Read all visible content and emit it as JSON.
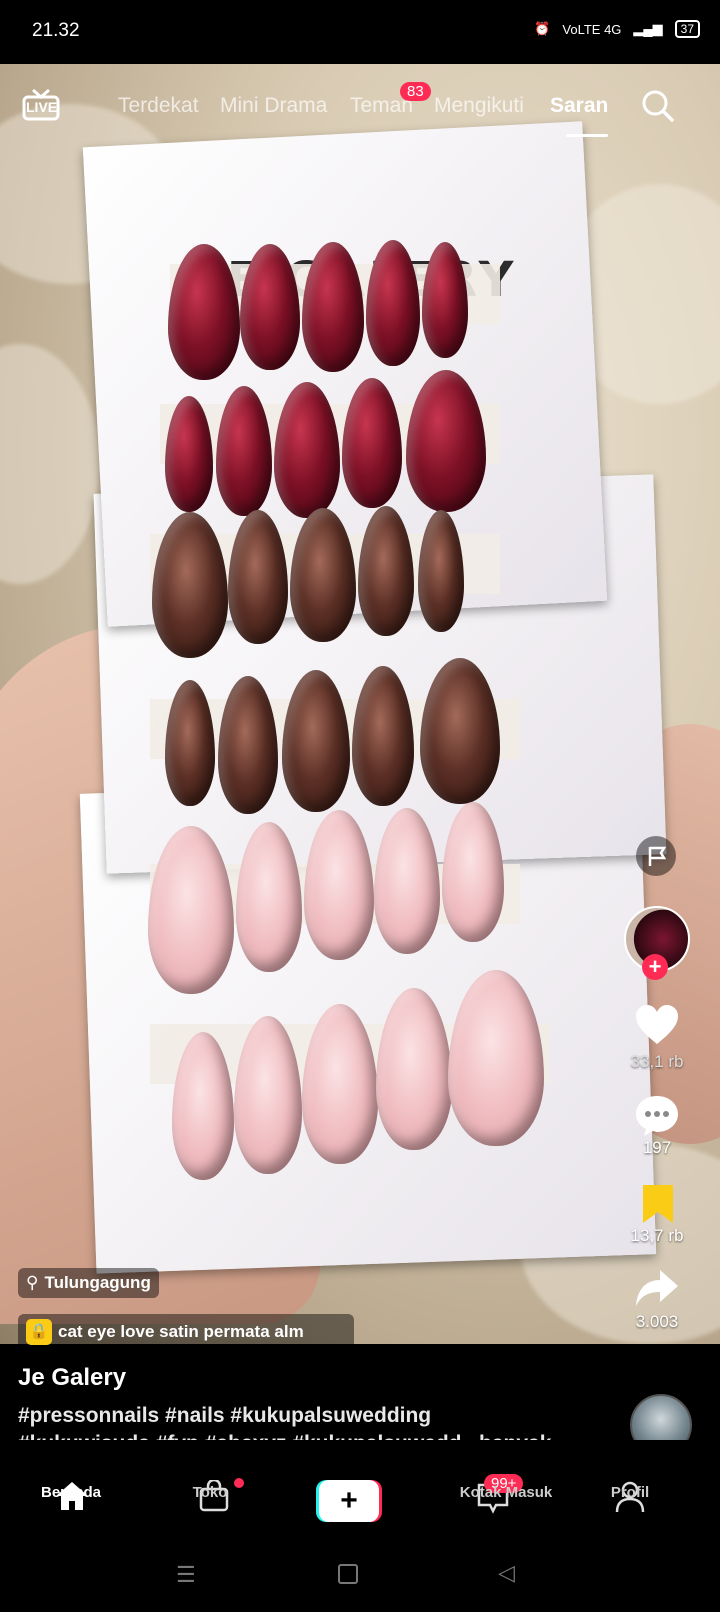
{
  "status_bar": {
    "time": "21.32",
    "network": "VoLTE 4G",
    "battery": "37"
  },
  "top_nav": {
    "live_label": "LIVE",
    "tabs": [
      "Terdekat",
      "Mini Drama",
      "Teman",
      "Mengikuti",
      "Saran"
    ],
    "active_tab": "Saran",
    "teman_badge": "83"
  },
  "video": {
    "brand_on_card": "JE GALERY",
    "location": "Tulungagung",
    "product": "cat eye love satin permata alm"
  },
  "actions": {
    "likes": "33,1 rb",
    "comments": "197",
    "saves": "13,7 rb",
    "shares": "3.003"
  },
  "post": {
    "author": "Je Galery",
    "caption_line1": "#pressonnails #nails #kukupalsuwedding",
    "caption_line2": "#kukuwisuda #fyp #abcxyz #kukupalsuwedd...banyak"
  },
  "tab_bar": {
    "home": "Beranda",
    "shop": "Toko",
    "inbox": "Kotak Masuk",
    "inbox_badge": "99+",
    "profile": "Profil"
  },
  "colors": {
    "accent": "#fe2c55",
    "cyan": "#25f4ee",
    "save_yellow": "#facc15"
  }
}
